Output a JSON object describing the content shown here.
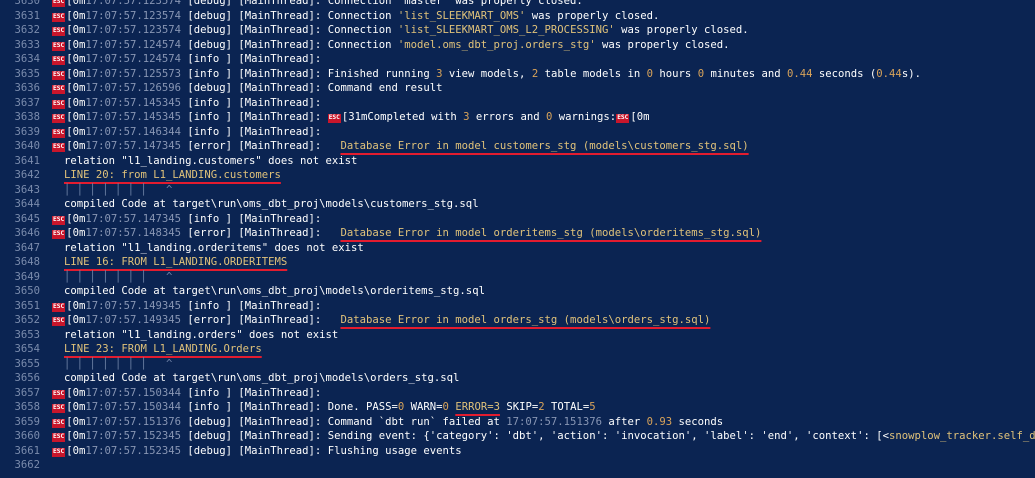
{
  "esc_glyph": "ESC",
  "lines": [
    {
      "n": "3630",
      "t": [
        [
          "esc"
        ],
        [
          "n",
          "[0m"
        ],
        [
          "d",
          "17:07:57.123574"
        ],
        [
          "n",
          " [debug] [MainThread]: Connection 'master' was properly closed."
        ]
      ]
    },
    {
      "n": "3631",
      "t": [
        [
          "esc"
        ],
        [
          "n",
          "[0m"
        ],
        [
          "d",
          "17:07:57.123574"
        ],
        [
          "n",
          " [debug] [MainThread]: Connection "
        ],
        [
          "s",
          "'list_SLEEKMART_OMS'"
        ],
        [
          "n",
          " was properly closed."
        ]
      ]
    },
    {
      "n": "3632",
      "t": [
        [
          "esc"
        ],
        [
          "n",
          "[0m"
        ],
        [
          "d",
          "17:07:57.123574"
        ],
        [
          "n",
          " [debug] [MainThread]: Connection "
        ],
        [
          "s",
          "'list_SLEEKMART_OMS_L2_PROCESSING'"
        ],
        [
          "n",
          " was properly closed."
        ]
      ]
    },
    {
      "n": "3633",
      "t": [
        [
          "esc"
        ],
        [
          "n",
          "[0m"
        ],
        [
          "d",
          "17:07:57.124574"
        ],
        [
          "n",
          " [debug] [MainThread]: Connection "
        ],
        [
          "s",
          "'model.oms_dbt_proj.orders_stg'"
        ],
        [
          "n",
          " was properly closed."
        ]
      ]
    },
    {
      "n": "3634",
      "t": [
        [
          "esc"
        ],
        [
          "n",
          "[0m"
        ],
        [
          "d",
          "17:07:57.124574"
        ],
        [
          "n",
          " [info ] [MainThread]:"
        ]
      ]
    },
    {
      "n": "3635",
      "t": [
        [
          "esc"
        ],
        [
          "n",
          "[0m"
        ],
        [
          "d",
          "17:07:57.125573"
        ],
        [
          "n",
          " [info ] [MainThread]: Finished running "
        ],
        [
          "num",
          "3"
        ],
        [
          "n",
          " view models, "
        ],
        [
          "num",
          "2"
        ],
        [
          "n",
          " table models in "
        ],
        [
          "num",
          "0"
        ],
        [
          "n",
          " hours "
        ],
        [
          "num",
          "0"
        ],
        [
          "n",
          " minutes and "
        ],
        [
          "num",
          "0.44"
        ],
        [
          "n",
          " seconds ("
        ],
        [
          "num",
          "0.44"
        ],
        [
          "n",
          "s)."
        ]
      ]
    },
    {
      "n": "3636",
      "t": [
        [
          "esc"
        ],
        [
          "n",
          "[0m"
        ],
        [
          "d",
          "17:07:57.126596"
        ],
        [
          "n",
          " [debug] [MainThread]: Command end result"
        ]
      ]
    },
    {
      "n": "3637",
      "t": [
        [
          "esc"
        ],
        [
          "n",
          "[0m"
        ],
        [
          "d",
          "17:07:57.145345"
        ],
        [
          "n",
          " [info ] [MainThread]:"
        ]
      ]
    },
    {
      "n": "3638",
      "t": [
        [
          "esc"
        ],
        [
          "n",
          "[0m"
        ],
        [
          "d",
          "17:07:57.145345"
        ],
        [
          "n",
          " [info ] [MainThread]: "
        ],
        [
          "esc"
        ],
        [
          "n",
          "[31mCompleted with "
        ],
        [
          "num",
          "3"
        ],
        [
          "n",
          " errors and "
        ],
        [
          "num",
          "0"
        ],
        [
          "n",
          " warnings:"
        ],
        [
          "esc"
        ],
        [
          "n",
          "[0m"
        ]
      ]
    },
    {
      "n": "3639",
      "t": [
        [
          "esc"
        ],
        [
          "n",
          "[0m"
        ],
        [
          "d",
          "17:07:57.146344"
        ],
        [
          "n",
          " [info ] [MainThread]:"
        ]
      ]
    },
    {
      "n": "3640",
      "t": [
        [
          "esc"
        ],
        [
          "n",
          "[0m"
        ],
        [
          "d",
          "17:07:57.147345"
        ],
        [
          "n",
          " [error] [MainThread]:   "
        ],
        [
          "u",
          "Database Error in model customers_stg (models\\customers_stg.sql)"
        ]
      ]
    },
    {
      "n": "3641",
      "t": [
        [
          "i"
        ],
        [
          "n",
          "relation \"l1_landing.customers\" does not exist"
        ]
      ]
    },
    {
      "n": "3642",
      "t": [
        [
          "i"
        ],
        [
          "u",
          "LINE 20: from L1_LANDING.customers"
        ]
      ]
    },
    {
      "n": "3643",
      "t": [
        [
          "i"
        ],
        [
          "g",
          "│ │ │ │ │ │ │   ^"
        ]
      ]
    },
    {
      "n": "3644",
      "t": [
        [
          "i"
        ],
        [
          "n",
          "compiled Code at target\\run\\oms_dbt_proj\\models\\customers_stg.sql"
        ]
      ]
    },
    {
      "n": "3645",
      "t": [
        [
          "esc"
        ],
        [
          "n",
          "[0m"
        ],
        [
          "d",
          "17:07:57.147345"
        ],
        [
          "n",
          " [info ] [MainThread]:"
        ]
      ]
    },
    {
      "n": "3646",
      "t": [
        [
          "esc"
        ],
        [
          "n",
          "[0m"
        ],
        [
          "d",
          "17:07:57.148345"
        ],
        [
          "n",
          " [error] [MainThread]:   "
        ],
        [
          "u",
          "Database Error in model orderitems_stg (models\\orderitems_stg.sql)"
        ]
      ]
    },
    {
      "n": "3647",
      "t": [
        [
          "i"
        ],
        [
          "n",
          "relation \"l1_landing.orderitems\" does not exist"
        ]
      ]
    },
    {
      "n": "3648",
      "t": [
        [
          "i"
        ],
        [
          "u",
          "LINE 16: FROM L1_LANDING.ORDERITEMS"
        ]
      ]
    },
    {
      "n": "3649",
      "t": [
        [
          "i"
        ],
        [
          "g",
          "│ │ │ │ │ │ │   ^"
        ]
      ]
    },
    {
      "n": "3650",
      "t": [
        [
          "i"
        ],
        [
          "n",
          "compiled Code at target\\run\\oms_dbt_proj\\models\\orderitems_stg.sql"
        ]
      ]
    },
    {
      "n": "3651",
      "t": [
        [
          "esc"
        ],
        [
          "n",
          "[0m"
        ],
        [
          "d",
          "17:07:57.149345"
        ],
        [
          "n",
          " [info ] [MainThread]:"
        ]
      ]
    },
    {
      "n": "3652",
      "t": [
        [
          "esc"
        ],
        [
          "n",
          "[0m"
        ],
        [
          "d",
          "17:07:57.149345"
        ],
        [
          "n",
          " [error] [MainThread]:   "
        ],
        [
          "u",
          "Database Error in model orders_stg (models\\orders_stg.sql)"
        ]
      ]
    },
    {
      "n": "3653",
      "t": [
        [
          "i"
        ],
        [
          "n",
          "relation \"l1_landing.orders\" does not exist"
        ]
      ]
    },
    {
      "n": "3654",
      "t": [
        [
          "i"
        ],
        [
          "u",
          "LINE 23: FROM L1_LANDING.Orders"
        ]
      ]
    },
    {
      "n": "3655",
      "t": [
        [
          "i"
        ],
        [
          "g",
          "│ │ │ │ │ │ │   ^"
        ]
      ]
    },
    {
      "n": "3656",
      "t": [
        [
          "i"
        ],
        [
          "n",
          "compiled Code at target\\run\\oms_dbt_proj\\models\\orders_stg.sql"
        ]
      ]
    },
    {
      "n": "3657",
      "t": [
        [
          "esc"
        ],
        [
          "n",
          "[0m"
        ],
        [
          "d",
          "17:07:57.150344"
        ],
        [
          "n",
          " [info ] [MainThread]:"
        ]
      ]
    },
    {
      "n": "3658",
      "t": [
        [
          "esc"
        ],
        [
          "n",
          "[0m"
        ],
        [
          "d",
          "17:07:57.150344"
        ],
        [
          "n",
          " [info ] [MainThread]: Done. PASS="
        ],
        [
          "num",
          "0"
        ],
        [
          "n",
          " WARN="
        ],
        [
          "num",
          "0"
        ],
        [
          "n",
          " "
        ],
        [
          "u",
          "ERROR=3"
        ],
        [
          "n",
          " SKIP="
        ],
        [
          "num",
          "2"
        ],
        [
          "n",
          " TOTAL="
        ],
        [
          "num",
          "5"
        ]
      ]
    },
    {
      "n": "3659",
      "t": [
        [
          "esc"
        ],
        [
          "n",
          "[0m"
        ],
        [
          "d",
          "17:07:57.151376"
        ],
        [
          "n",
          " [debug] [MainThread]: Command `dbt run` failed at "
        ],
        [
          "d",
          "17:07:57.151376"
        ],
        [
          "n",
          " after "
        ],
        [
          "num",
          "0.93"
        ],
        [
          "n",
          " seconds"
        ]
      ]
    },
    {
      "n": "3660",
      "t": [
        [
          "esc"
        ],
        [
          "n",
          "[0m"
        ],
        [
          "d",
          "17:07:57.152345"
        ],
        [
          "n",
          " [debug] [MainThread]: Sending event: {'category': 'dbt', 'action': 'invocation', 'label': 'end', 'context': [<"
        ],
        [
          "s",
          "snowplow_tracker.self_describing_json"
        ]
      ]
    },
    {
      "n": "3661",
      "t": [
        [
          "esc"
        ],
        [
          "n",
          "[0m"
        ],
        [
          "d",
          "17:07:57.152345"
        ],
        [
          "n",
          " [debug] [MainThread]: Flushing usage events"
        ]
      ]
    },
    {
      "n": "3662",
      "t": []
    }
  ]
}
